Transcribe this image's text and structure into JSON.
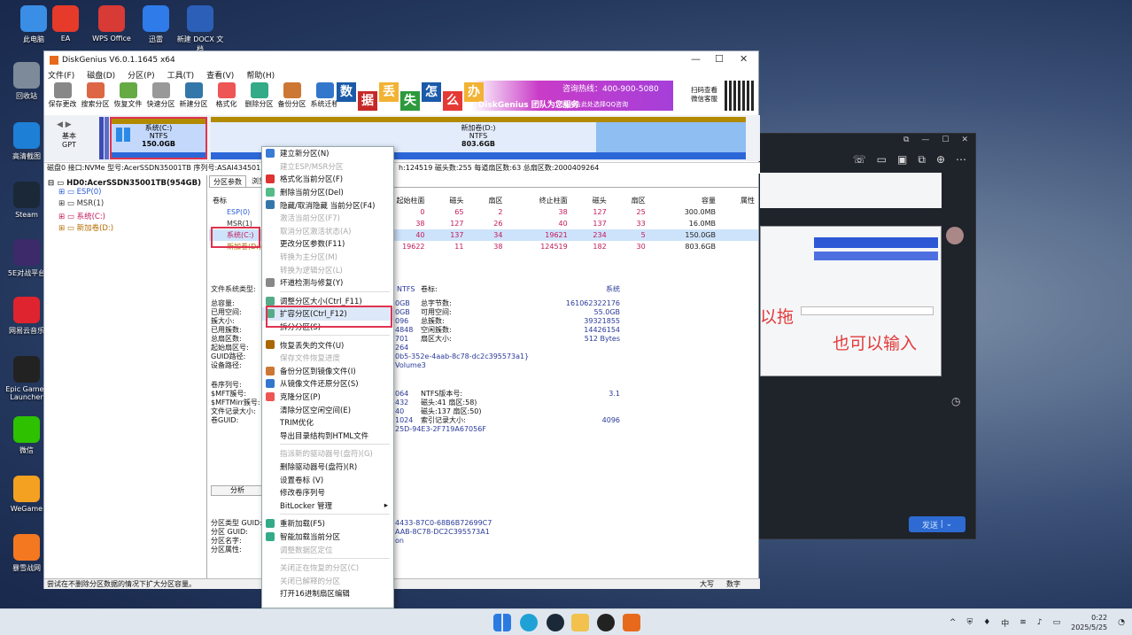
{
  "desktop": {
    "icons": [
      {
        "label": "此电脑",
        "color": "#3a8ee6"
      },
      {
        "label": "EA",
        "color": "#e63a2a"
      },
      {
        "label": "WPS Office",
        "color": "#d83a35"
      },
      {
        "label": "迅雷",
        "color": "#2f7bea"
      },
      {
        "label": "新建 DOCX 文档",
        "color": "#2b5fb8"
      },
      {
        "label": "回收站",
        "color": "#7d8a99"
      },
      {
        "label": "高清截图",
        "color": "#1d7fd6"
      },
      {
        "label": "Steam",
        "color": "#1b2838"
      },
      {
        "label": "5E对战平台",
        "color": "#3c2a6b"
      },
      {
        "label": "网易云音乐",
        "color": "#e0242f"
      },
      {
        "label": "Epic Games Launcher",
        "color": "#222"
      },
      {
        "label": "微信",
        "color": "#2dc100"
      },
      {
        "label": "WeGame",
        "color": "#f4a020"
      },
      {
        "label": "暴雪战网",
        "color": "#f47820"
      }
    ]
  },
  "window": {
    "title": "DiskGenius V6.0.1.1645 x64",
    "controls": [
      "—",
      "☐",
      "✕"
    ],
    "menu": [
      "文件(F)",
      "磁盘(D)",
      "分区(P)",
      "工具(T)",
      "查看(V)",
      "帮助(H)"
    ],
    "toolbar": [
      "保存更改",
      "搜索分区",
      "恢复文件",
      "快速分区",
      "新建分区",
      "格式化",
      "删除分区",
      "备份分区",
      "系统迁移"
    ],
    "banner": {
      "chars": [
        "数",
        "据",
        "丢",
        "失",
        "怎",
        "么",
        "办"
      ],
      "slogan": "DiskGenius 团队为您服务",
      "phone": "咨询热线：400-900-5080",
      "sub": "或点击此处选择QQ咨询",
      "scan": "扫码查看 微信客服"
    },
    "disk": {
      "type_label": "基本",
      "style": "GPT",
      "system_label": "系统(C:)",
      "system_fs": "NTFS",
      "system_size": "150.0GB",
      "new_label": "新加卷(D:)",
      "new_fs": "NTFS",
      "new_size": "803.6GB"
    },
    "diskinfo": "磁盘0 接口:NVMe  型号:AcerSSDN35001TB  序列号:ASAI4345015",
    "diskinfo2": "h:124519  磁头数:255  每道扇区数:63  总扇区数:2000409264",
    "tree": {
      "root": "HD0:AcerSSDN35001TB(954GB)",
      "items": [
        {
          "name": "ESP(0)",
          "color": "#2a5bd7"
        },
        {
          "name": "MSR(1)",
          "color": "#333"
        },
        {
          "name": "系统(C:)",
          "color": "#c2185b"
        },
        {
          "name": "新加卷(D:)",
          "color": "#b36b00"
        }
      ]
    },
    "tabs": [
      "分区参数",
      "浏览"
    ],
    "table": {
      "headers": [
        "卷标",
        "",
        "标识",
        "起始柱面",
        "磁头",
        "扇区",
        "终止柱面",
        "磁头",
        "扇区",
        "容量",
        "属性"
      ],
      "rows": [
        {
          "label": "ESP(0)",
          "c": [
            "0",
            "65",
            "2",
            "38",
            "127",
            "25",
            "300.0MB"
          ]
        },
        {
          "label": "MSR(1)",
          "c": [
            "38",
            "127",
            "26",
            "40",
            "137",
            "33",
            "16.0MB"
          ]
        },
        {
          "label": "系统(C:)",
          "c": [
            "40",
            "137",
            "34",
            "19621",
            "234",
            "5",
            "150.0GB"
          ]
        },
        {
          "label": "新加卷(D:)",
          "c": [
            "19622",
            "11",
            "38",
            "124519",
            "182",
            "30",
            "803.6GB"
          ]
        }
      ]
    },
    "details": {
      "left_labels": [
        "文件系统类型:",
        "总容量:",
        "已用空间:",
        "簇大小:",
        "已用簇数:",
        "总扇区数:",
        "起始扇区号:",
        "GUID路径:",
        "设备路径:",
        "卷序列号:",
        "$MFT簇号:",
        "$MFTMirr簇号:",
        "文件记录大小:",
        "卷GUID:"
      ],
      "fs": "NTFS",
      "fs_label": "卷标:",
      "sys": "系统",
      "mid_vals": [
        "0GB",
        "0GB",
        "096",
        "4848",
        "701",
        "264",
        "0b5-352e-4aab-8c78-dc2c395573a1}",
        "Volume3",
        "064",
        "432",
        "40",
        "1024",
        "25D-94E3-2F719A67056F"
      ],
      "right_labels": [
        "总字节数:",
        "可用空间:",
        "总簇数:",
        "空闲簇数:",
        "扇区大小:",
        "NTFS版本号:",
        "磁头:41 扇区:58)",
        "磁头:137 扇区:50)",
        "索引记录大小:"
      ],
      "right_vals": [
        "161062322176",
        "55.0GB",
        "39321855",
        "14426154",
        "512 Bytes",
        "3.1",
        "",
        "",
        "4096"
      ],
      "analyze": "分析",
      "guid_labels": [
        "分区类型 GUID:",
        "分区 GUID:",
        "分区名字:",
        "分区属性:"
      ],
      "guid_vals": [
        "4433-87C0-68B6B72699C7",
        "AAB-8C78-DC2C395573A1",
        "on",
        ""
      ]
    },
    "status": "尝试在不删除分区数据的情况下扩大分区容量。",
    "status_right": [
      "大写",
      "数字"
    ]
  },
  "context_menu": [
    {
      "t": "建立新分区(N)",
      "d": false,
      "c": "#3a7bd5"
    },
    {
      "t": "建立ESP/MSR分区",
      "d": true
    },
    {
      "t": "格式化当前分区(F)",
      "d": false,
      "c": "#d33"
    },
    {
      "t": "删除当前分区(Del)",
      "d": false,
      "c": "#5b8"
    },
    {
      "t": "隐藏/取消隐藏 当前分区(F4)",
      "d": false,
      "c": "#37a"
    },
    {
      "t": "激活当前分区(F7)",
      "d": true
    },
    {
      "t": "取消分区激活状态(A)",
      "d": true
    },
    {
      "t": "更改分区参数(F11)",
      "d": false
    },
    {
      "t": "转换为主分区(M)",
      "d": true
    },
    {
      "t": "转换为逻辑分区(L)",
      "d": true
    },
    {
      "t": "坏道检测与修复(Y)",
      "d": false,
      "c": "#888"
    },
    {
      "sep": true
    },
    {
      "t": "调整分区大小(Ctrl_F11)",
      "d": false,
      "c": "#5a8"
    },
    {
      "t": "扩容分区(Ctrl_F12)",
      "d": false,
      "c": "#5a8",
      "hl": true
    },
    {
      "t": "拆分分区(S)",
      "d": false
    },
    {
      "sep": true
    },
    {
      "t": "恢复丢失的文件(U)",
      "d": false,
      "c": "#a60"
    },
    {
      "t": "保存文件恢复进度",
      "d": true
    },
    {
      "t": "备份分区到镜像文件(I)",
      "d": false,
      "c": "#c73"
    },
    {
      "t": "从镜像文件还原分区(S)",
      "d": false,
      "c": "#37c"
    },
    {
      "t": "克隆分区(P)",
      "d": false,
      "c": "#e55"
    },
    {
      "t": "清除分区空闲空间(E)",
      "d": false
    },
    {
      "t": "TRIM优化",
      "d": false
    },
    {
      "t": "导出目录结构到HTML文件",
      "d": false
    },
    {
      "sep": true
    },
    {
      "t": "指派新的驱动器号(盘符)(G)",
      "d": true
    },
    {
      "t": "删除驱动器号(盘符)(R)",
      "d": false
    },
    {
      "t": "设置卷标 (V)",
      "d": false
    },
    {
      "t": "修改卷序列号",
      "d": false
    },
    {
      "t": "BitLocker 管理",
      "d": false,
      "arrow": "▸"
    },
    {
      "sep": true
    },
    {
      "t": "重新加载(F5)",
      "d": false,
      "c": "#3a8"
    },
    {
      "t": "智能加载当前分区",
      "d": false,
      "c": "#3a8"
    },
    {
      "t": "调整数据区定位",
      "d": true
    },
    {
      "sep": true
    },
    {
      "t": "关闭正在恢复的分区(C)",
      "d": true
    },
    {
      "t": "关闭已解释的分区",
      "d": true
    },
    {
      "t": "打开16进制扇区编辑",
      "d": false
    }
  ],
  "chat": {
    "annotation1": "以拖",
    "annotation2": "也可以输入",
    "send": "发送",
    "send_arrow": "⌄"
  },
  "taskbar": {
    "tray_lang": "中",
    "time": "0:22",
    "date": "2025/5/25"
  }
}
